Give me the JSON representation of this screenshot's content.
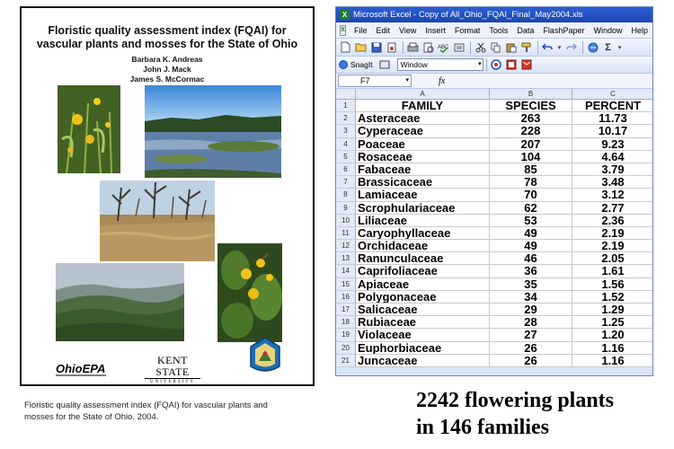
{
  "cover": {
    "title_line1": "Floristic quality assessment index (FQAI) for",
    "title_line2": "vascular plants and mosses for the State of Ohio",
    "authors": [
      "Barbara K. Andreas",
      "John J. Mack",
      "James S. McCormac"
    ],
    "logos": {
      "left": "OhioEPA",
      "center_top": "KENT STATE",
      "center_bottom": "UNIVERSITY"
    }
  },
  "caption": {
    "line1": "Floristic quality assessment index (FQAI) for vascular plants and",
    "line2": "mosses for the State of Ohio. 2004."
  },
  "note": {
    "line1": "2242 flowering plants",
    "line2": "in  146 families"
  },
  "excel": {
    "title": "Microsoft Excel - Copy of All_Ohio_FQAI_Final_May2004.xls",
    "menu": [
      "File",
      "Edit",
      "View",
      "Insert",
      "Format",
      "Tools",
      "Data",
      "FlashPaper",
      "Window",
      "Help"
    ],
    "snagit_label": "SnagIt",
    "window_dropdown": "Window",
    "name_box": "F7",
    "fx_label": "fx",
    "column_letters": [
      "A",
      "B",
      "C"
    ],
    "headers": [
      "FAMILY",
      "SPECIES",
      "PERCENT"
    ],
    "rows": [
      {
        "n": "2",
        "family": "Asteraceae",
        "species": "263",
        "percent": "11.73"
      },
      {
        "n": "3",
        "family": "Cyperaceae",
        "species": "228",
        "percent": "10.17"
      },
      {
        "n": "4",
        "family": "Poaceae",
        "species": "207",
        "percent": "9.23"
      },
      {
        "n": "5",
        "family": "Rosaceae",
        "species": "104",
        "percent": "4.64"
      },
      {
        "n": "6",
        "family": "Fabaceae",
        "species": "85",
        "percent": "3.79"
      },
      {
        "n": "7",
        "family": "Brassicaceae",
        "species": "78",
        "percent": "3.48"
      },
      {
        "n": "8",
        "family": "Lamiaceae",
        "species": "70",
        "percent": "3.12"
      },
      {
        "n": "9",
        "family": "Scrophulariaceae",
        "species": "62",
        "percent": "2.77"
      },
      {
        "n": "10",
        "family": "Liliaceae",
        "species": "53",
        "percent": "2.36"
      },
      {
        "n": "11",
        "family": "Caryophyllaceae",
        "species": "49",
        "percent": "2.19"
      },
      {
        "n": "12",
        "family": "Orchidaceae",
        "species": "49",
        "percent": "2.19"
      },
      {
        "n": "13",
        "family": "Ranunculaceae",
        "species": "46",
        "percent": "2.05"
      },
      {
        "n": "14",
        "family": "Caprifoliaceae",
        "species": "36",
        "percent": "1.61"
      },
      {
        "n": "15",
        "family": "Apiaceae",
        "species": "35",
        "percent": "1.56"
      },
      {
        "n": "16",
        "family": "Polygonaceae",
        "species": "34",
        "percent": "1.52"
      },
      {
        "n": "17",
        "family": "Salicaceae",
        "species": "29",
        "percent": "1.29"
      },
      {
        "n": "18",
        "family": "Rubiaceae",
        "species": "28",
        "percent": "1.25"
      },
      {
        "n": "19",
        "family": "Violaceae",
        "species": "27",
        "percent": "1.20"
      },
      {
        "n": "20",
        "family": "Euphorbiaceae",
        "species": "26",
        "percent": "1.16"
      },
      {
        "n": "21",
        "family": "Juncaceae",
        "species": "26",
        "percent": "1.16"
      }
    ]
  }
}
